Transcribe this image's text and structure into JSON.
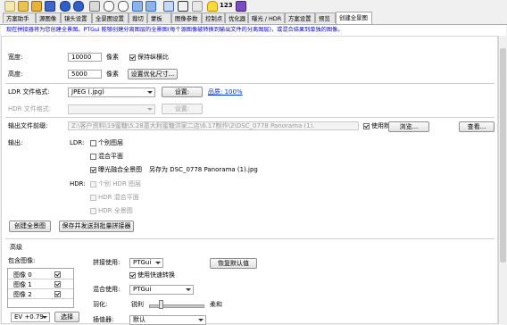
{
  "toolbar": {
    "icons": [
      "new-file-icon",
      "open-folder-icon",
      "save-icon",
      "save-as-icon",
      "undo-icon",
      "redo-icon",
      "align-icon",
      "zoom-in-icon",
      "zoom-out-icon",
      "back-icon",
      "forward-icon",
      "preview-icon",
      "table-icon",
      "checkpoint-icon",
      "lightbulb-icon"
    ],
    "counter": "123"
  },
  "tabs": [
    "方案助手",
    "源图像",
    "镜头设置",
    "全景图设置",
    "裁切",
    "蒙板",
    "图像参数",
    "控制点",
    "优化器",
    "曝光 / HDR",
    "方案设置",
    "预览",
    "创建全景图"
  ],
  "active_tab_index": 12,
  "banner": "现在拼接器将为您创建全景图。PTGui 能够创建分离图层的全景图(每个源图像被转换到输出文件的分离图层)，或混合结果到单独的图像。",
  "form": {
    "width_label": "宽度:",
    "width_value": "10000",
    "width_unit": "像素",
    "keep_ratio_label": "保持纵横比",
    "height_label": "高度:",
    "height_value": "5000",
    "height_unit": "像素",
    "optimal_size_button": "设置优化尺寸...",
    "ldr_format_label": "LDR 文件格式:",
    "ldr_format_value": "JPEG (.jpg)",
    "ldr_settings_button": "设置:",
    "quality_link": "品质: 100%",
    "hdr_format_label": "HDR 文件格式:",
    "hdr_settings_button": "设置:",
    "prefix_label": "输出文件前缀:",
    "prefix_value": "Z:\\客户资料\\19蜜糖\\5.28意大利蜜糖洪家二店\\6.17制作\\2\\DSC_0778 Panorama (1).",
    "use_default_label": "使用默认",
    "browse_button": "浏览...",
    "view_button": "查看...",
    "output_label": "输出:",
    "ldr_label": "LDR:",
    "ldr_options": [
      "个别图层",
      "混合平面",
      "曝光融合全景图"
    ],
    "save_as_text": "另存为 DSC_0778 Panorama (1).jpg",
    "hdr_label": "HDR:",
    "hdr_options": [
      "个别 HDR 图层",
      "HDR 混合平面",
      "HDR 全景图"
    ],
    "create_button": "创建全景图",
    "save_batch_button": "保存并发送到批量拼接器"
  },
  "advanced": {
    "section_label": "高级",
    "include_label": "包含图像:",
    "images": [
      "图像 0",
      "图像 1",
      "图像 2"
    ],
    "ev_value": "EV +0.79",
    "select_button": "选择",
    "stitcher_label": "拼接使用:",
    "stitcher_value": "PTGui",
    "fast_transform_label": "使用快速转换",
    "restore_default_button": "恢复默认值",
    "blender_label": "混合使用:",
    "blender_value": "PTGui",
    "feather_label": "羽化:",
    "feather_sharp": "锐利",
    "feather_soft": "柔和",
    "interp_label": "插值器:",
    "interp_value": "默认"
  }
}
